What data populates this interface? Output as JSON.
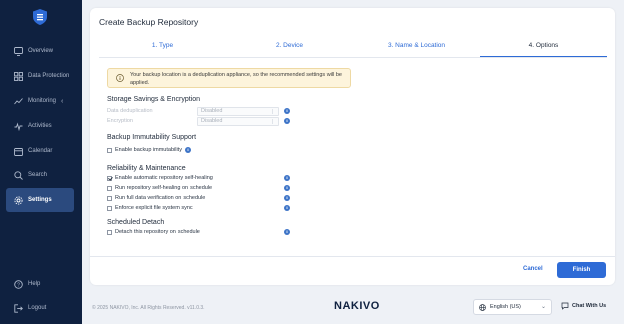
{
  "sidebar": {
    "items": [
      {
        "label": "Overview"
      },
      {
        "label": "Data Protection"
      },
      {
        "label": "Monitoring"
      },
      {
        "label": "Activities"
      },
      {
        "label": "Calendar"
      },
      {
        "label": "Search"
      },
      {
        "label": "Settings"
      }
    ],
    "bottom": [
      {
        "label": "Help"
      },
      {
        "label": "Logout"
      }
    ]
  },
  "wizard": {
    "title": "Create Backup Repository",
    "steps": [
      "1. Type",
      "2. Device",
      "3. Name & Location",
      "4. Options"
    ],
    "active_step": 4,
    "notice": "Your backup location is a deduplication appliance, so the recommended settings will be applied.",
    "storage": {
      "title": "Storage Savings & Encryption",
      "dedup_label": "Data deduplication",
      "dedup_value": "Disabled",
      "enc_label": "Encryption",
      "enc_value": "Disabled"
    },
    "immutability": {
      "title": "Backup Immutability Support",
      "enable_label": "Enable backup immutability",
      "enable_checked": false
    },
    "reliability": {
      "title": "Reliability & Maintenance",
      "items": [
        {
          "label": "Enable automatic repository self-healing",
          "checked": true
        },
        {
          "label": "Run repository self-healing on",
          "link": "schedule",
          "checked": false
        },
        {
          "label": "Run full data verification on",
          "link": "schedule",
          "checked": false
        },
        {
          "label": "Enforce explicit file system sync",
          "checked": false
        }
      ]
    },
    "detach": {
      "title": "Scheduled Detach",
      "label": "Detach this repository on",
      "link": "schedule",
      "checked": false
    },
    "cancel_label": "Cancel",
    "finish_label": "Finish"
  },
  "footer": {
    "copyright": "© 2025 NAKIVO, Inc. All Rights Reserved. v11.0.3.",
    "brand": "NAKIVO",
    "language": "English (US)",
    "chat_label": "Chat With Us"
  },
  "colors": {
    "sidebar_bg": "#0f2140",
    "accent": "#2e6bd6",
    "notice_bg": "#fdf4dc"
  }
}
